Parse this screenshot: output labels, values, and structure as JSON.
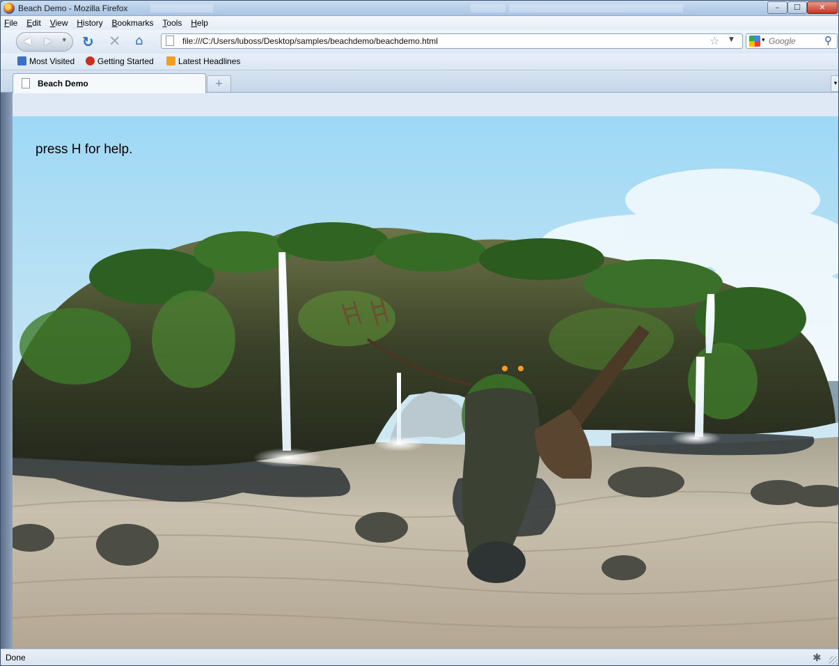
{
  "window": {
    "title": "Beach Demo - Mozilla Firefox",
    "buttons": {
      "minimize": "–",
      "maximize": "☐",
      "close": "✕"
    }
  },
  "menu": {
    "items": [
      "File",
      "Edit",
      "View",
      "History",
      "Bookmarks",
      "Tools",
      "Help"
    ]
  },
  "navigation": {
    "back_icon": "back-arrow-icon",
    "forward_icon": "forward-arrow-icon",
    "url": "file:///C:/Users/luboss/Desktop/samples/beachdemo/beachdemo.html",
    "search_placeholder": "Google"
  },
  "bookmarks": {
    "items": [
      {
        "label": "Most Visited",
        "color": "#3a6fc9"
      },
      {
        "label": "Getting Started",
        "color": "#c8311d"
      },
      {
        "label": "Latest Headlines",
        "color": "#f0a020"
      }
    ]
  },
  "tabs": {
    "items": [
      {
        "label": "Beach Demo",
        "active": true
      }
    ],
    "new_tab_label": "+"
  },
  "content": {
    "help_text": "press H for help."
  },
  "status": {
    "text": "Done"
  },
  "colors": {
    "sky_top": "#9fd9f5",
    "sand": "#c9bfae",
    "rock": "#3c4233",
    "foliage": "#3f7a2a",
    "waterfall": "#f4f8fb"
  }
}
